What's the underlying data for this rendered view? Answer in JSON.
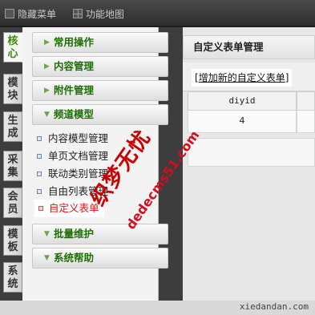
{
  "topbar": {
    "hide_menu": "隐藏菜单",
    "site_map": "功能地图"
  },
  "vtabs": [
    "核心",
    "模块",
    "生成",
    "采集",
    "会员",
    "模板",
    "系统"
  ],
  "menu": {
    "sections": [
      "常用操作",
      "内容管理",
      "附件管理",
      "频道模型",
      "批量维护",
      "系统帮助"
    ],
    "items": [
      "内容模型管理",
      "单页文档管理",
      "联动类别管理",
      "自由列表管理",
      "自定义表单"
    ]
  },
  "content": {
    "title": "自定义表单管理",
    "add_prefix": "[",
    "add_link": "增加新的自定义表单",
    "add_suffix": "]",
    "table": {
      "headers": [
        "diyid"
      ],
      "rows": [
        [
          "4"
        ]
      ]
    }
  },
  "watermark": {
    "name": "织梦无忧",
    "url": "dedecms51.com"
  },
  "footer": "xiedandan.com"
}
